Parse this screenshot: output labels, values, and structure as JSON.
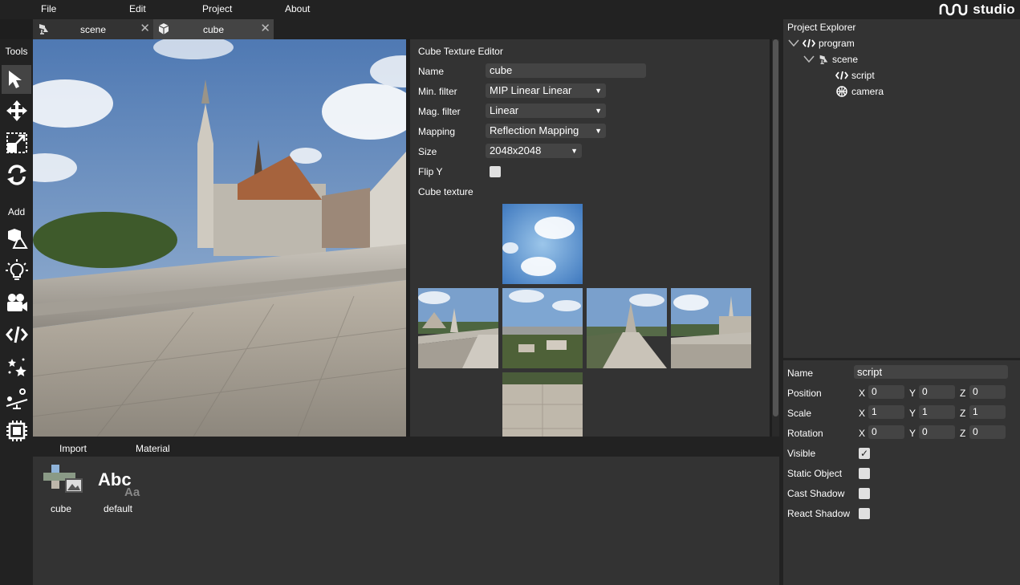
{
  "menu": {
    "file": "File",
    "edit": "Edit",
    "project": "Project",
    "about": "About"
  },
  "logo": {
    "text": "studio"
  },
  "tabs": [
    {
      "label": "scene",
      "icon": "scene-icon",
      "close": "✕"
    },
    {
      "label": "cube",
      "icon": "cube-icon",
      "close": "✕"
    }
  ],
  "toolbar": {
    "tools_label": "Tools",
    "add_label": "Add",
    "tools": [
      "select-arrow-icon",
      "move-icon",
      "scale-icon",
      "rotate-icon"
    ],
    "add_items": [
      "add-model-icon",
      "add-light-icon",
      "add-camera-icon",
      "add-script-icon",
      "add-effects-icon",
      "add-physics-icon",
      "add-container-icon"
    ]
  },
  "editor": {
    "title": "Cube Texture Editor",
    "name_label": "Name",
    "name_value": "cube",
    "min_filter_label": "Min. filter",
    "min_filter_value": "MIP Linear Linear",
    "mag_filter_label": "Mag. filter",
    "mag_filter_value": "Linear",
    "mapping_label": "Mapping",
    "mapping_value": "Reflection Mapping",
    "size_label": "Size",
    "size_value": "2048x2048",
    "flip_y_label": "Flip Y",
    "flip_y_checked": false,
    "cube_texture_label": "Cube texture",
    "dropdown_arrow": "▼"
  },
  "asset_panel": {
    "tabs": [
      "Import",
      "Material"
    ],
    "assets": [
      {
        "name": "cube",
        "icon": "cube-texture-icon"
      },
      {
        "name": "default",
        "icon": "material-icon",
        "icon_text": "Abc",
        "icon_subtext": "Aa"
      }
    ]
  },
  "explorer": {
    "title": "Project Explorer",
    "tree": [
      {
        "label": "program",
        "icon": "code-icon",
        "expanded": true,
        "level": 0
      },
      {
        "label": "scene",
        "icon": "scene-icon",
        "expanded": true,
        "level": 1
      },
      {
        "label": "script",
        "icon": "code-icon",
        "level": 2
      },
      {
        "label": "camera",
        "icon": "camera-sphere-icon",
        "level": 2
      }
    ],
    "expand_glyph": "∨"
  },
  "inspector": {
    "name_label": "Name",
    "name_value": "script",
    "position_label": "Position",
    "position": {
      "x": "0",
      "y": "0",
      "z": "0"
    },
    "scale_label": "Scale",
    "scale": {
      "x": "1",
      "y": "1",
      "z": "1"
    },
    "rotation_label": "Rotation",
    "rotation": {
      "x": "0",
      "y": "0",
      "z": "0"
    },
    "axis_x": "X",
    "axis_y": "Y",
    "axis_z": "Z",
    "visible_label": "Visible",
    "visible": true,
    "static_label": "Static Object",
    "static": false,
    "cast_shadow_label": "Cast Shadow",
    "cast_shadow": false,
    "react_shadow_label": "React Shadow",
    "react_shadow": false,
    "check_glyph": "✓"
  }
}
